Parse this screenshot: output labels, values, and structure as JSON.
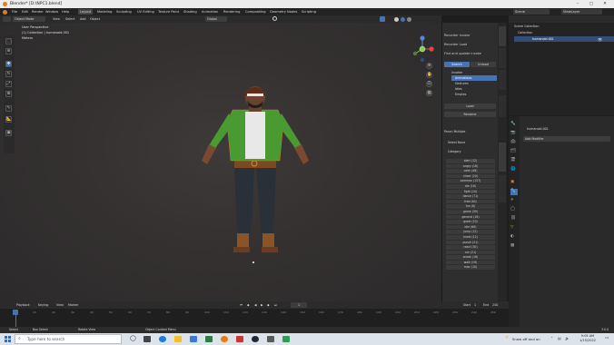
{
  "window": {
    "title": "Blender* [D:\\NPC1.blend]",
    "controls": [
      "–",
      "▢",
      "✕"
    ]
  },
  "menus": [
    "File",
    "Edit",
    "Render",
    "Window",
    "Help"
  ],
  "workspaces": [
    "Layout",
    "Modeling",
    "Sculpting",
    "UV Editing",
    "Texture Paint",
    "Shading",
    "Animation",
    "Rendering",
    "Compositing",
    "Geometry Nodes",
    "Scripting"
  ],
  "active_workspace": "Layout",
  "header": {
    "mode": "Object Mode",
    "menus": [
      "View",
      "Select",
      "Add",
      "Object"
    ],
    "orientation": "Global",
    "scene": "Scene",
    "view_layer": "ViewLayer"
  },
  "viewport_info": {
    "l1": "User Perspective",
    "l2": "(1) Collection | humanoid.001",
    "l3": "Meters"
  },
  "npanel": {
    "tabs": [
      "Item",
      "Tool",
      "View",
      "Blendkit",
      "Create"
    ],
    "b1": "Recorder Invoke",
    "b2": "Recorder Load",
    "b3": "Find and update invoke",
    "tab_a": "Search",
    "tab_b": "Unload",
    "tree": [
      "Invoker",
      "Animations",
      "Gestures",
      "Idles",
      "Emotes"
    ],
    "active": "Animations",
    "btn_load": "Load",
    "btn_name": "Rename",
    "filter_head": "Panel: Multiple",
    "opt1": "Select None",
    "opt2": "Category",
    "cat": [
      "alert (12)",
      "angry (16)",
      "calm (48)",
      "cheer (20)",
      "common (157)",
      "die (16)",
      "fight (10)",
      "dance (71)",
      "free (40)",
      "fun (6)",
      "game (30)",
      "general (16)",
      "greet (20)",
      "idle (66)",
      "jump (12)",
      "kneel (12)",
      "punch (21)",
      "react (30)",
      "run (21)",
      "sneak (16)",
      "walk (19)",
      "misc (10)"
    ]
  },
  "outliner": {
    "root": "Scene Collection",
    "coll": "Collection",
    "obj": "humanoid.001"
  },
  "properties": {
    "name": "humanoid.001",
    "field": "Add Modifier"
  },
  "timeline": {
    "menus": [
      "Playback",
      "Keying",
      "View",
      "Marker"
    ],
    "current_frame": "1",
    "start_label": "Start",
    "start": "1",
    "end_label": "End",
    "end": "250",
    "ticks": [
      "0",
      "10",
      "20",
      "30",
      "40",
      "50",
      "60",
      "70",
      "80",
      "90",
      "100",
      "110",
      "120",
      "130",
      "140",
      "150",
      "160",
      "170",
      "180",
      "190",
      "200",
      "210",
      "220",
      "230",
      "240",
      "250"
    ]
  },
  "status": {
    "s1": "Select",
    "s2": "Box Select",
    "s3": "Rotate View",
    "s4": "Object Context Menu",
    "version": "3.0.0"
  },
  "taskbar": {
    "search": "Type here to search",
    "weather": "Snow off and on",
    "time": "9:05 AM",
    "date": "1/15/2022"
  },
  "colors": {
    "accent": "#4772b3",
    "green_shirt": "#4a9a32",
    "selection": "#e8812b"
  }
}
